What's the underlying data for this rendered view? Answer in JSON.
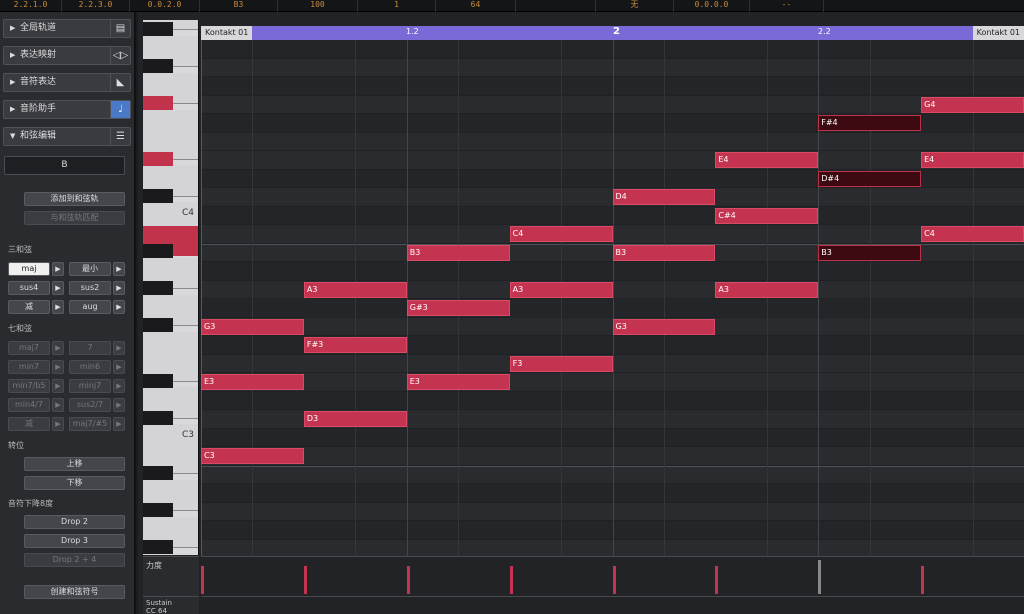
{
  "topbar": {
    "cells": [
      "2.2.1.0",
      "2.2.3.0",
      "0.0.2.0",
      "B3",
      "100",
      "1",
      "64",
      "",
      "无",
      "0.0.0.0",
      "--"
    ]
  },
  "panel": {
    "sections": [
      {
        "label": "全局轨道",
        "icon": "▤"
      },
      {
        "label": "表达映射",
        "icon": "◁▷"
      },
      {
        "label": "音符表达",
        "icon": "◣"
      },
      {
        "label": "音阶助手",
        "icon": "♩"
      },
      {
        "label": "和弦编辑",
        "icon": "☰"
      }
    ],
    "chord_name": "B",
    "add_to_chord_track": "添加到和弦轨",
    "from_chord_track": "与和弦轨匹配",
    "triad_label": "三和弦",
    "triads": [
      "maj",
      "最小",
      "sus4",
      "sus2",
      "减",
      "aug"
    ],
    "seventh_label": "七和弦",
    "sevenths": [
      "maj7",
      "7",
      "min7",
      "min6",
      "min7/b5",
      "minj7",
      "min4/7",
      "sus2/7",
      "减",
      "maj7/#5"
    ],
    "inversion_label": "转位",
    "move_up": "上移",
    "move_down": "下移",
    "drop_label": "音符下降8度",
    "drop2": "Drop 2",
    "drop3": "Drop 3",
    "drop24": "Drop 2 + 4",
    "create_symbol": "创建和弦符号"
  },
  "ruler": {
    "part_left": "Kontakt 01",
    "part_right": "Kontakt 01",
    "m1": "1.2",
    "m2": "2",
    "m3": "2.2"
  },
  "keys": {
    "c4": "C4",
    "c3": "C3"
  },
  "notes": [
    {
      "name": "G4",
      "pitch": 67,
      "start": 0.875,
      "len": 0.125,
      "dark": false
    },
    {
      "name": "F#4",
      "pitch": 66,
      "start": 0.75,
      "len": 0.125,
      "dark": true
    },
    {
      "name": "E4",
      "pitch": 64,
      "start": 0.625,
      "len": 0.125,
      "dark": false
    },
    {
      "name": "E4",
      "pitch": 64,
      "start": 0.875,
      "len": 0.125,
      "dark": false
    },
    {
      "name": "D#4",
      "pitch": 63,
      "start": 0.75,
      "len": 0.125,
      "dark": true
    },
    {
      "name": "D4",
      "pitch": 62,
      "start": 0.5,
      "len": 0.125,
      "dark": false
    },
    {
      "name": "C#4",
      "pitch": 61,
      "start": 0.625,
      "len": 0.125,
      "dark": false
    },
    {
      "name": "C4",
      "pitch": 60,
      "start": 0.375,
      "len": 0.125,
      "dark": false
    },
    {
      "name": "C4",
      "pitch": 60,
      "start": 0.875,
      "len": 0.125,
      "dark": false
    },
    {
      "name": "B3",
      "pitch": 59,
      "start": 0.25,
      "len": 0.125,
      "dark": false
    },
    {
      "name": "B3",
      "pitch": 59,
      "start": 0.5,
      "len": 0.125,
      "dark": false
    },
    {
      "name": "B3",
      "pitch": 59,
      "start": 0.75,
      "len": 0.125,
      "dark": true
    },
    {
      "name": "A3",
      "pitch": 57,
      "start": 0.125,
      "len": 0.125,
      "dark": false
    },
    {
      "name": "A3",
      "pitch": 57,
      "start": 0.375,
      "len": 0.125,
      "dark": false
    },
    {
      "name": "A3",
      "pitch": 57,
      "start": 0.625,
      "len": 0.125,
      "dark": false
    },
    {
      "name": "G#3",
      "pitch": 56,
      "start": 0.25,
      "len": 0.125,
      "dark": false
    },
    {
      "name": "G3",
      "pitch": 55,
      "start": 0.0,
      "len": 0.125,
      "dark": false
    },
    {
      "name": "G3",
      "pitch": 55,
      "start": 0.5,
      "len": 0.125,
      "dark": false
    },
    {
      "name": "F#3",
      "pitch": 54,
      "start": 0.125,
      "len": 0.125,
      "dark": false
    },
    {
      "name": "F3",
      "pitch": 53,
      "start": 0.375,
      "len": 0.125,
      "dark": false
    },
    {
      "name": "E3",
      "pitch": 52,
      "start": 0.0,
      "len": 0.125,
      "dark": false
    },
    {
      "name": "E3",
      "pitch": 52,
      "start": 0.25,
      "len": 0.125,
      "dark": false
    },
    {
      "name": "D3",
      "pitch": 50,
      "start": 0.125,
      "len": 0.125,
      "dark": false
    },
    {
      "name": "C3",
      "pitch": 48,
      "start": 0.0,
      "len": 0.125,
      "dark": false
    }
  ],
  "velocity_lane": {
    "label": "力度"
  },
  "sustain_lane": {
    "label": "Sustain\nCC 64"
  },
  "colors": {
    "note": "#c43450",
    "ruler": "#7a6ad8"
  }
}
